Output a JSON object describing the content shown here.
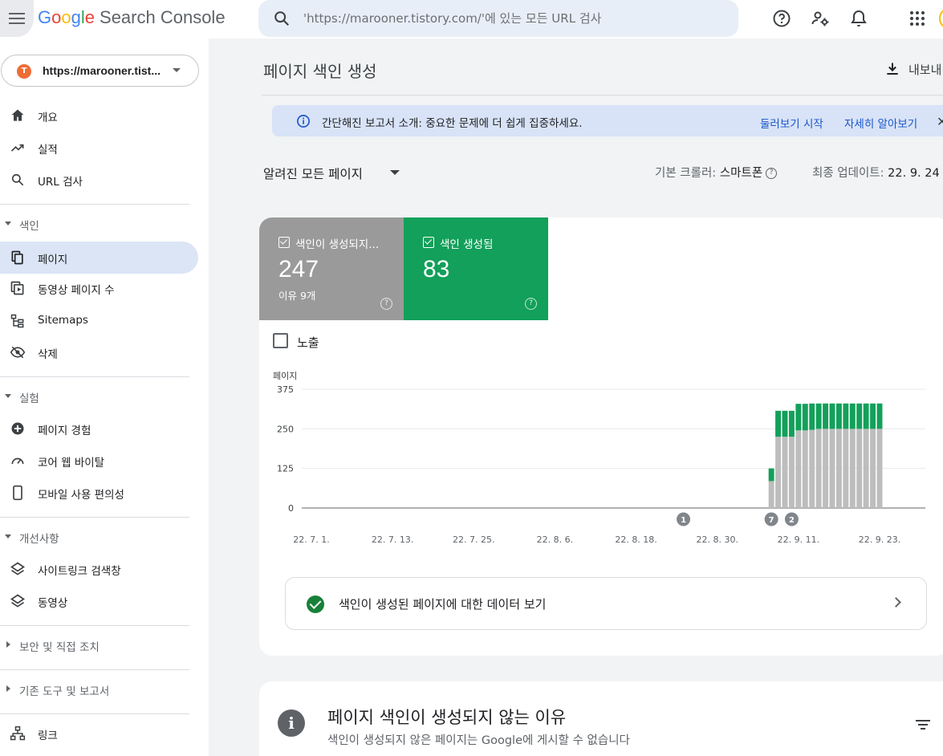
{
  "header": {
    "app_title_google": "Google",
    "app_title_product": "Search Console",
    "search_placeholder": "'https://marooner.tistory.com/'에 있는 모든 URL 검사",
    "icons": [
      "menu-icon",
      "search-icon",
      "help-icon",
      "settings-icon",
      "notifications-icon",
      "apps-icon"
    ]
  },
  "property": {
    "url": "https://marooner.tist...",
    "favicon_text": "T"
  },
  "sidebar": {
    "top_items": [
      {
        "label": "개요",
        "icon": "home-icon"
      },
      {
        "label": "실적",
        "icon": "trending-icon"
      },
      {
        "label": "URL 검사",
        "icon": "search-icon"
      }
    ],
    "sections": [
      {
        "label": "색인",
        "expanded": true,
        "items": [
          {
            "label": "페이지",
            "icon": "pages-icon",
            "active": true
          },
          {
            "label": "동영상 페이지 수",
            "icon": "video-pages-icon"
          },
          {
            "label": "Sitemaps",
            "icon": "sitemap-icon"
          },
          {
            "label": "삭제",
            "icon": "removal-icon"
          }
        ]
      },
      {
        "label": "실험",
        "expanded": true,
        "items": [
          {
            "label": "페이지 경험",
            "icon": "page-experience-icon"
          },
          {
            "label": "코어 웹 바이탈",
            "icon": "gauge-icon"
          },
          {
            "label": "모바일 사용 편의성",
            "icon": "mobile-icon"
          }
        ]
      },
      {
        "label": "개선사항",
        "expanded": true,
        "items": [
          {
            "label": "사이트링크 검색창",
            "icon": "layers-icon"
          },
          {
            "label": "동영상",
            "icon": "layers-icon"
          }
        ]
      },
      {
        "label": "보안 및 직접 조치",
        "expanded": false
      },
      {
        "label": "기존 도구 및 보고서",
        "expanded": false
      }
    ],
    "bottom_items": [
      {
        "label": "링크",
        "icon": "links-icon"
      }
    ]
  },
  "main": {
    "title": "페이지 색인 생성",
    "export_label": "내보내",
    "banner": {
      "text": "간단해진 보고서 소개: 중요한 문제에 더 쉽게 집중하세요.",
      "link1": "둘러보기 시작",
      "link2": "자세히 알아보기"
    },
    "filter_label": "알려진 모든 페이지",
    "crawler_label": "기본 크롤러:",
    "crawler_value": "스마트폰",
    "last_update_label": "최종 업데이트:",
    "last_update_value": "22. 9. 24",
    "tiles": [
      {
        "label": "색인이 생성되지...",
        "value": "247",
        "sub": "이유 9개",
        "color": "#9a9a9a"
      },
      {
        "label": "색인 생성됨",
        "value": "83",
        "sub": "",
        "color": "#12a05a"
      }
    ],
    "impressions_label": "노출",
    "view_data_link": "색인이 생성된 페이지에 대한 데이터 보기",
    "reasons_title": "페이지 색인이 생성되지 않는 이유",
    "reasons_subtitle": "색인이 생성되지 않은 페이지는 Google에 게시할 수 없습니다"
  },
  "chart_data": {
    "type": "bar",
    "stacked": true,
    "ylabel": "페이지",
    "ylim": [
      0,
      375
    ],
    "yticks": [
      0,
      125,
      250,
      375
    ],
    "xticks": [
      "22. 7. 1.",
      "22. 7. 13.",
      "22. 7. 25.",
      "22. 8. 6.",
      "22. 8. 18.",
      "22. 8. 30.",
      "22. 9. 11.",
      "22. 9. 23."
    ],
    "annotations": [
      {
        "label": "1",
        "x": "22. 8. 25."
      },
      {
        "label": "7",
        "x": "22. 9. 7."
      },
      {
        "label": "2",
        "x": "22. 9. 10."
      }
    ],
    "x": [
      "22. 9. 7.",
      "22. 9. 8.",
      "22. 9. 9.",
      "22. 9. 10.",
      "22. 9. 11.",
      "22. 9. 12.",
      "22. 9. 13.",
      "22. 9. 14.",
      "22. 9. 15.",
      "22. 9. 16.",
      "22. 9. 17.",
      "22. 9. 18.",
      "22. 9. 19.",
      "22. 9. 20.",
      "22. 9. 21.",
      "22. 9. 22.",
      "22. 9. 23."
    ],
    "series": [
      {
        "name": "색인이 생성되지 않음",
        "color": "#bdbdbd",
        "values": [
          85,
          225,
          225,
          225,
          245,
          245,
          247,
          250,
          250,
          250,
          250,
          250,
          250,
          250,
          250,
          250,
          250
        ]
      },
      {
        "name": "색인 생성됨",
        "color": "#12a05a",
        "values": [
          40,
          82,
          82,
          82,
          84,
          84,
          83,
          80,
          80,
          80,
          80,
          80,
          80,
          80,
          80,
          80,
          80
        ]
      }
    ]
  }
}
